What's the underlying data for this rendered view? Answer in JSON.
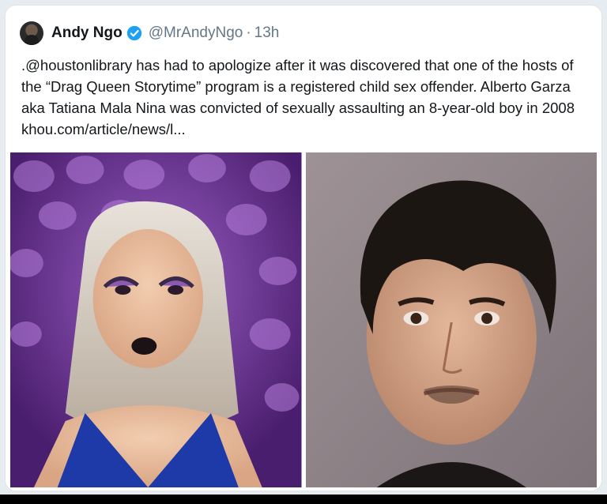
{
  "tweet": {
    "author": {
      "name": "Andy Ngo",
      "handle": "@MrAndyNgo",
      "verified": true
    },
    "separator": "·",
    "time": "13h",
    "text": ".@houstonlibrary has had to apologize after it was discovered that one of the hosts of the “Drag Queen Storytime” program is a registered child sex offender. Alberto Garza aka Tatiana Mala Nina was convicted of sexually assaulting an 8-year-old boy in 2008 khou.com/article/news/l...",
    "media": [
      {
        "icon": "drag-performer-photo"
      },
      {
        "icon": "mugshot-photo"
      }
    ]
  },
  "colors": {
    "name_text": "#14171a",
    "secondary_text": "#657786",
    "verified_badge": "#1da1f2",
    "card_background": "#ffffff"
  }
}
